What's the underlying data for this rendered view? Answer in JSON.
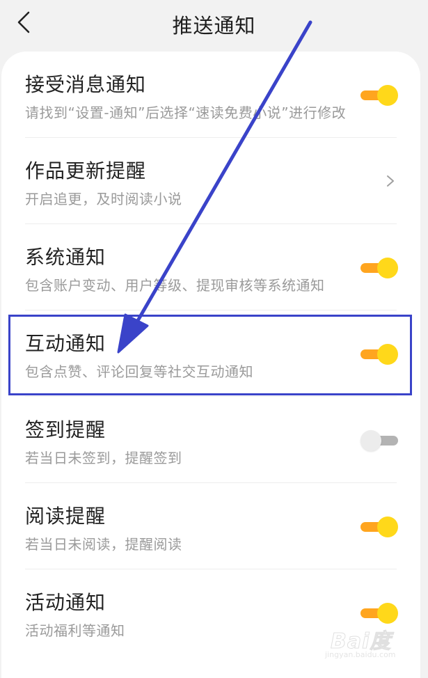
{
  "header": {
    "title": "推送通知",
    "back_icon": "chevron-left-icon"
  },
  "settings": [
    {
      "title": "接受消息通知",
      "description": "请找到“设置-通知”后选择“速读免费小说”进行修改",
      "control": "toggle",
      "on": true
    },
    {
      "title": "作品更新提醒",
      "description": "开启追更，及时阅读小说",
      "control": "chevron"
    },
    {
      "title": "系统通知",
      "description": "包含账户变动、用户等级、提现审核等系统通知",
      "control": "toggle",
      "on": true
    },
    {
      "title": "互动通知",
      "description": "包含点赞、评论回复等社交互动通知",
      "control": "toggle",
      "on": true,
      "highlighted": true
    },
    {
      "title": "签到提醒",
      "description": "若当日未签到，提醒签到",
      "control": "toggle",
      "on": false
    },
    {
      "title": "阅读提醒",
      "description": "若当日未阅读，提醒阅读",
      "control": "toggle",
      "on": true
    },
    {
      "title": "活动通知",
      "description": "活动福利等通知",
      "control": "toggle",
      "on": true
    }
  ],
  "annotation": {
    "color": "#3a43c9"
  },
  "watermark": {
    "text": "Bai度",
    "url": "jingyan.baidu.com"
  },
  "colors": {
    "toggle_on_track": "#ffa51f",
    "toggle_on_knob": "#ffd81a",
    "toggle_off_track": "#b3b3b3",
    "toggle_off_knob": "#ececec",
    "background": "#f2f2f2"
  }
}
